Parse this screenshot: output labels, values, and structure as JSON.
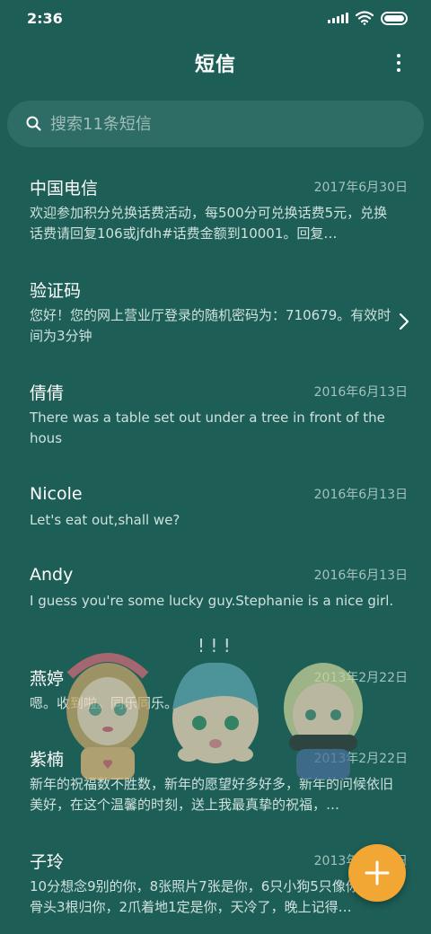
{
  "status_bar": {
    "time": "2:36"
  },
  "header": {
    "title": "短信"
  },
  "search": {
    "placeholder": "搜索11条短信"
  },
  "conversations": [
    {
      "name": "中国电信",
      "date": "2017年6月30日",
      "preview": "欢迎参加积分兑换话费活动，每500分可兑换话费5元，兑换话费请回复106或jfdh#话费金额到10001。回复…"
    },
    {
      "name": "验证码",
      "date": "",
      "preview": "您好！您的网上营业厅登录的随机密码为：710679。有效时间为3分钟"
    },
    {
      "name": "倩倩",
      "date": "2016年6月13日",
      "preview": "There was a table set out under a tree in front of the hous"
    },
    {
      "name": "Nicole",
      "date": "2016年6月13日",
      "preview": "Let's eat out,shall we?"
    },
    {
      "name": "Andy",
      "date": "2016年6月13日",
      "preview": "I guess you're some lucky guy.Stephanie is a nice girl."
    },
    {
      "name": "燕婷",
      "date": "2013年2月22日",
      "preview": "嗯。收到啦。同乐同乐。"
    },
    {
      "name": "紫楠",
      "date": "2013年2月22日",
      "preview": "新年的祝福数不胜数，新年的愿望好多好多，新年的问候依旧美好，在这个温馨的时刻，送上我最真挚的祝福，…"
    },
    {
      "name": "子玲",
      "date": "2013年2月22日",
      "preview": "10分想念9别的你，8张照片7张是你，6只小狗5只像你，4根骨头3根归你，2爪着地1定是你，天冷了，晚上记得…"
    }
  ],
  "colors": {
    "background": "#1d5e56",
    "search_bg": "#2d6d65",
    "fab": "#f2a734"
  },
  "icons": {
    "menu": "more-vertical-icon",
    "search": "search-icon",
    "fab": "plus-icon",
    "chevron": "chevron-right-icon"
  }
}
